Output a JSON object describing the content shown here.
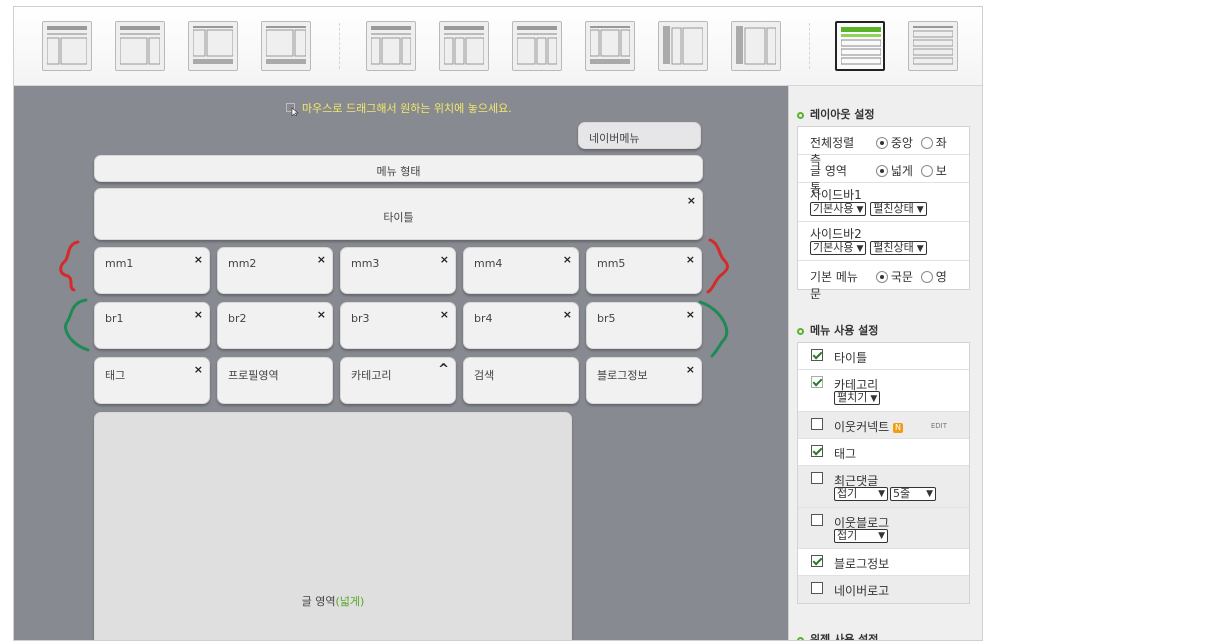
{
  "hint": "마우스로 드래그해서 원하는 위치에 놓으세요.",
  "canvas": {
    "nav_menu": "네이버메뉴",
    "menu_type": "메뉴 형태",
    "title": "타이틀",
    "row_mm": [
      "mm1",
      "mm2",
      "mm3",
      "mm4",
      "mm5"
    ],
    "row_br": [
      "br1",
      "br2",
      "br3",
      "br4",
      "br5"
    ],
    "row_widgets": [
      "태그",
      "프로필영역",
      "카테고리",
      "검색",
      "블로그정보"
    ],
    "close_glyph": "×",
    "collapse_glyph": "^",
    "content_label": "글 영역",
    "content_wide": "(넓게)"
  },
  "layout_settings": {
    "title": "레이아웃 설정",
    "align_label": "전체정렬",
    "align_center": "중앙",
    "align_left": "좌측",
    "content_label": "글 영역",
    "content_wide": "넓게",
    "content_normal": "보통",
    "sidebar1_label": "사이드바1",
    "sidebar2_label": "사이드바2",
    "sidebar_use": "기본사용",
    "sidebar_state": "펼친상태",
    "basic_menu_label": "기본 메뉴",
    "basic_menu_kr": "국문",
    "basic_menu_en": "영문"
  },
  "menu_settings": {
    "title": "메뉴 사용 설정",
    "items": {
      "title": "타이틀",
      "category": "카테고리",
      "category_opt": "펼치기",
      "neighbor_connect": "이웃커넥트",
      "badge": "N",
      "edit": "EDIT",
      "tag": "태그",
      "recent_comments": "최근댓글",
      "fold": "접기",
      "lines": "5줄",
      "neighbor_blog": "이웃블로그",
      "blog_info": "블로그정보",
      "naver_logo": "네이버로고"
    }
  },
  "widget_settings": {
    "title": "위젯 사용 설정"
  },
  "colors": {
    "canvas": "#888a91",
    "accent_green": "#59b22d",
    "hint_yellow": "#f2e86a",
    "brace_red": "#d42a2a",
    "brace_green": "#1e8a55"
  }
}
